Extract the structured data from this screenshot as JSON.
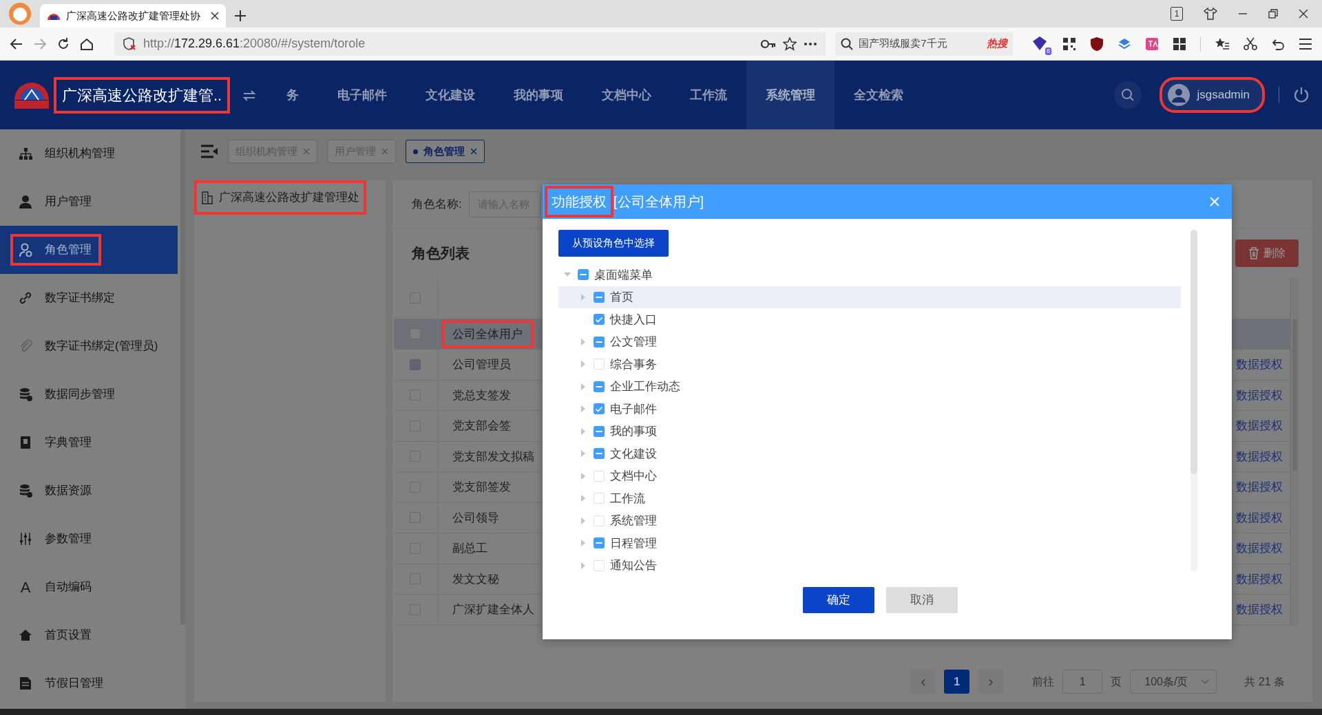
{
  "browser": {
    "tab_title": "广深高速公路改扩建管理处协",
    "tab_count": "1",
    "url": {
      "scheme": "http://",
      "host": "172.29.6.61",
      "rest": ":20080/#/system/torole"
    },
    "search": {
      "text": "国产羽绒服卖7千元",
      "hot": "热搜"
    },
    "extension_badge": "8"
  },
  "header": {
    "title": "广深高速公路改扩建管..",
    "title_marked": true,
    "nav": [
      {
        "label": "务",
        "selected": false
      },
      {
        "label": "电子邮件",
        "selected": false
      },
      {
        "label": "文化建设",
        "selected": false
      },
      {
        "label": "我的事项",
        "selected": false
      },
      {
        "label": "文档中心",
        "selected": false
      },
      {
        "label": "工作流",
        "selected": false
      },
      {
        "label": "系统管理",
        "selected": true
      },
      {
        "label": "全文检索",
        "selected": false
      }
    ],
    "user": {
      "name": "jsgsadmin",
      "marked": true
    }
  },
  "sidebar": {
    "items": [
      {
        "label": "组织机构管理",
        "selected": false,
        "marked": false
      },
      {
        "label": "用户管理",
        "selected": false,
        "marked": false
      },
      {
        "label": "角色管理",
        "selected": true,
        "marked": true
      },
      {
        "label": "数字证书绑定",
        "selected": false,
        "marked": false
      },
      {
        "label": "数字证书绑定(管理员)",
        "selected": false,
        "marked": false
      },
      {
        "label": "数据同步管理",
        "selected": false,
        "marked": false
      },
      {
        "label": "字典管理",
        "selected": false,
        "marked": false
      },
      {
        "label": "数据资源",
        "selected": false,
        "marked": false
      },
      {
        "label": "参数管理",
        "selected": false,
        "marked": false
      },
      {
        "label": "自动编码",
        "selected": false,
        "marked": false,
        "icon_glyph": "A"
      },
      {
        "label": "首页设置",
        "selected": false,
        "marked": false
      },
      {
        "label": "节假日管理",
        "selected": false,
        "marked": false
      }
    ]
  },
  "page_tabs": [
    {
      "label": "组织机构管理",
      "selected": false
    },
    {
      "label": "用户管理",
      "selected": false
    },
    {
      "label": "角色管理",
      "selected": true
    }
  ],
  "org_tree": {
    "label": "广深高速公路改扩建管理处",
    "marked": true
  },
  "filter": {
    "label": "角色名称:",
    "placeholder": "请输入名称"
  },
  "role_list": {
    "title": "角色列表",
    "delete_button": "删除",
    "all_checked": false,
    "rows": [
      {
        "name": "公司全体用户",
        "selected": true,
        "marked": true,
        "disabled": false
      },
      {
        "name": "公司管理员",
        "selected": false,
        "marked": false,
        "disabled": true,
        "action": "数据授权"
      },
      {
        "name": "党总支签发",
        "selected": false,
        "marked": false,
        "disabled": false,
        "action": "数据授权"
      },
      {
        "name": "党支部会签",
        "selected": false,
        "marked": false,
        "disabled": false,
        "action": "数据授权"
      },
      {
        "name": "党支部发文拟稿",
        "selected": false,
        "marked": false,
        "disabled": false,
        "action": "数据授权"
      },
      {
        "name": "党支部签发",
        "selected": false,
        "marked": false,
        "disabled": false,
        "action": "数据授权"
      },
      {
        "name": "公司领导",
        "selected": false,
        "marked": false,
        "disabled": false,
        "action": "数据授权"
      },
      {
        "name": "副总工",
        "selected": false,
        "marked": false,
        "disabled": false,
        "action": "数据授权"
      },
      {
        "name": "发文文秘",
        "selected": false,
        "marked": false,
        "disabled": false,
        "action": "数据授权"
      },
      {
        "name": "广深扩建全体人",
        "selected": false,
        "marked": false,
        "disabled": false,
        "action": "数据授权"
      }
    ]
  },
  "pagination": {
    "prev": "‹",
    "next": "›",
    "current": "1",
    "goto_label": "前往",
    "goto_value": "1",
    "page_unit": "页",
    "page_size": "100条/页",
    "total": "共 21 条"
  },
  "dialog": {
    "title": "功能授权",
    "title_marked": true,
    "subtitle": "[公司全体用户]",
    "preset_button": "从预设角色中选择",
    "tree": [
      {
        "label": "桌面端菜单",
        "checked": false,
        "indeterminate": true,
        "expanded": true,
        "hovered": false,
        "has_children": true,
        "children": [
          {
            "label": "首页",
            "checked": false,
            "indeterminate": true,
            "expanded": false,
            "hovered": true,
            "has_children": true
          },
          {
            "label": "快捷入口",
            "checked": true,
            "hovered": false,
            "has_children": false
          },
          {
            "label": "公文管理",
            "checked": false,
            "indeterminate": true,
            "expanded": false,
            "hovered": false,
            "has_children": true
          },
          {
            "label": "综合事务",
            "checked": false,
            "indeterminate": false,
            "expanded": false,
            "hovered": false,
            "has_children": true
          },
          {
            "label": "企业工作动态",
            "checked": false,
            "indeterminate": true,
            "expanded": false,
            "hovered": false,
            "has_children": true
          },
          {
            "label": "电子邮件",
            "checked": true,
            "expanded": false,
            "hovered": false,
            "has_children": true
          },
          {
            "label": "我的事项",
            "checked": false,
            "indeterminate": true,
            "expanded": false,
            "hovered": false,
            "has_children": true
          },
          {
            "label": "文化建设",
            "checked": false,
            "indeterminate": true,
            "expanded": false,
            "hovered": false,
            "has_children": true
          },
          {
            "label": "文档中心",
            "checked": false,
            "indeterminate": false,
            "expanded": false,
            "hovered": false,
            "has_children": true
          },
          {
            "label": "工作流",
            "checked": false,
            "indeterminate": false,
            "expanded": false,
            "hovered": false,
            "has_children": true
          },
          {
            "label": "系统管理",
            "checked": false,
            "indeterminate": false,
            "expanded": false,
            "hovered": false,
            "has_children": true
          },
          {
            "label": "日程管理",
            "checked": false,
            "indeterminate": true,
            "expanded": false,
            "hovered": false,
            "has_children": true
          },
          {
            "label": "通知公告",
            "checked": false,
            "indeterminate": false,
            "expanded": false,
            "hovered": false,
            "has_children": true
          }
        ]
      }
    ],
    "ok_button": "确定",
    "cancel_button": "取消"
  }
}
